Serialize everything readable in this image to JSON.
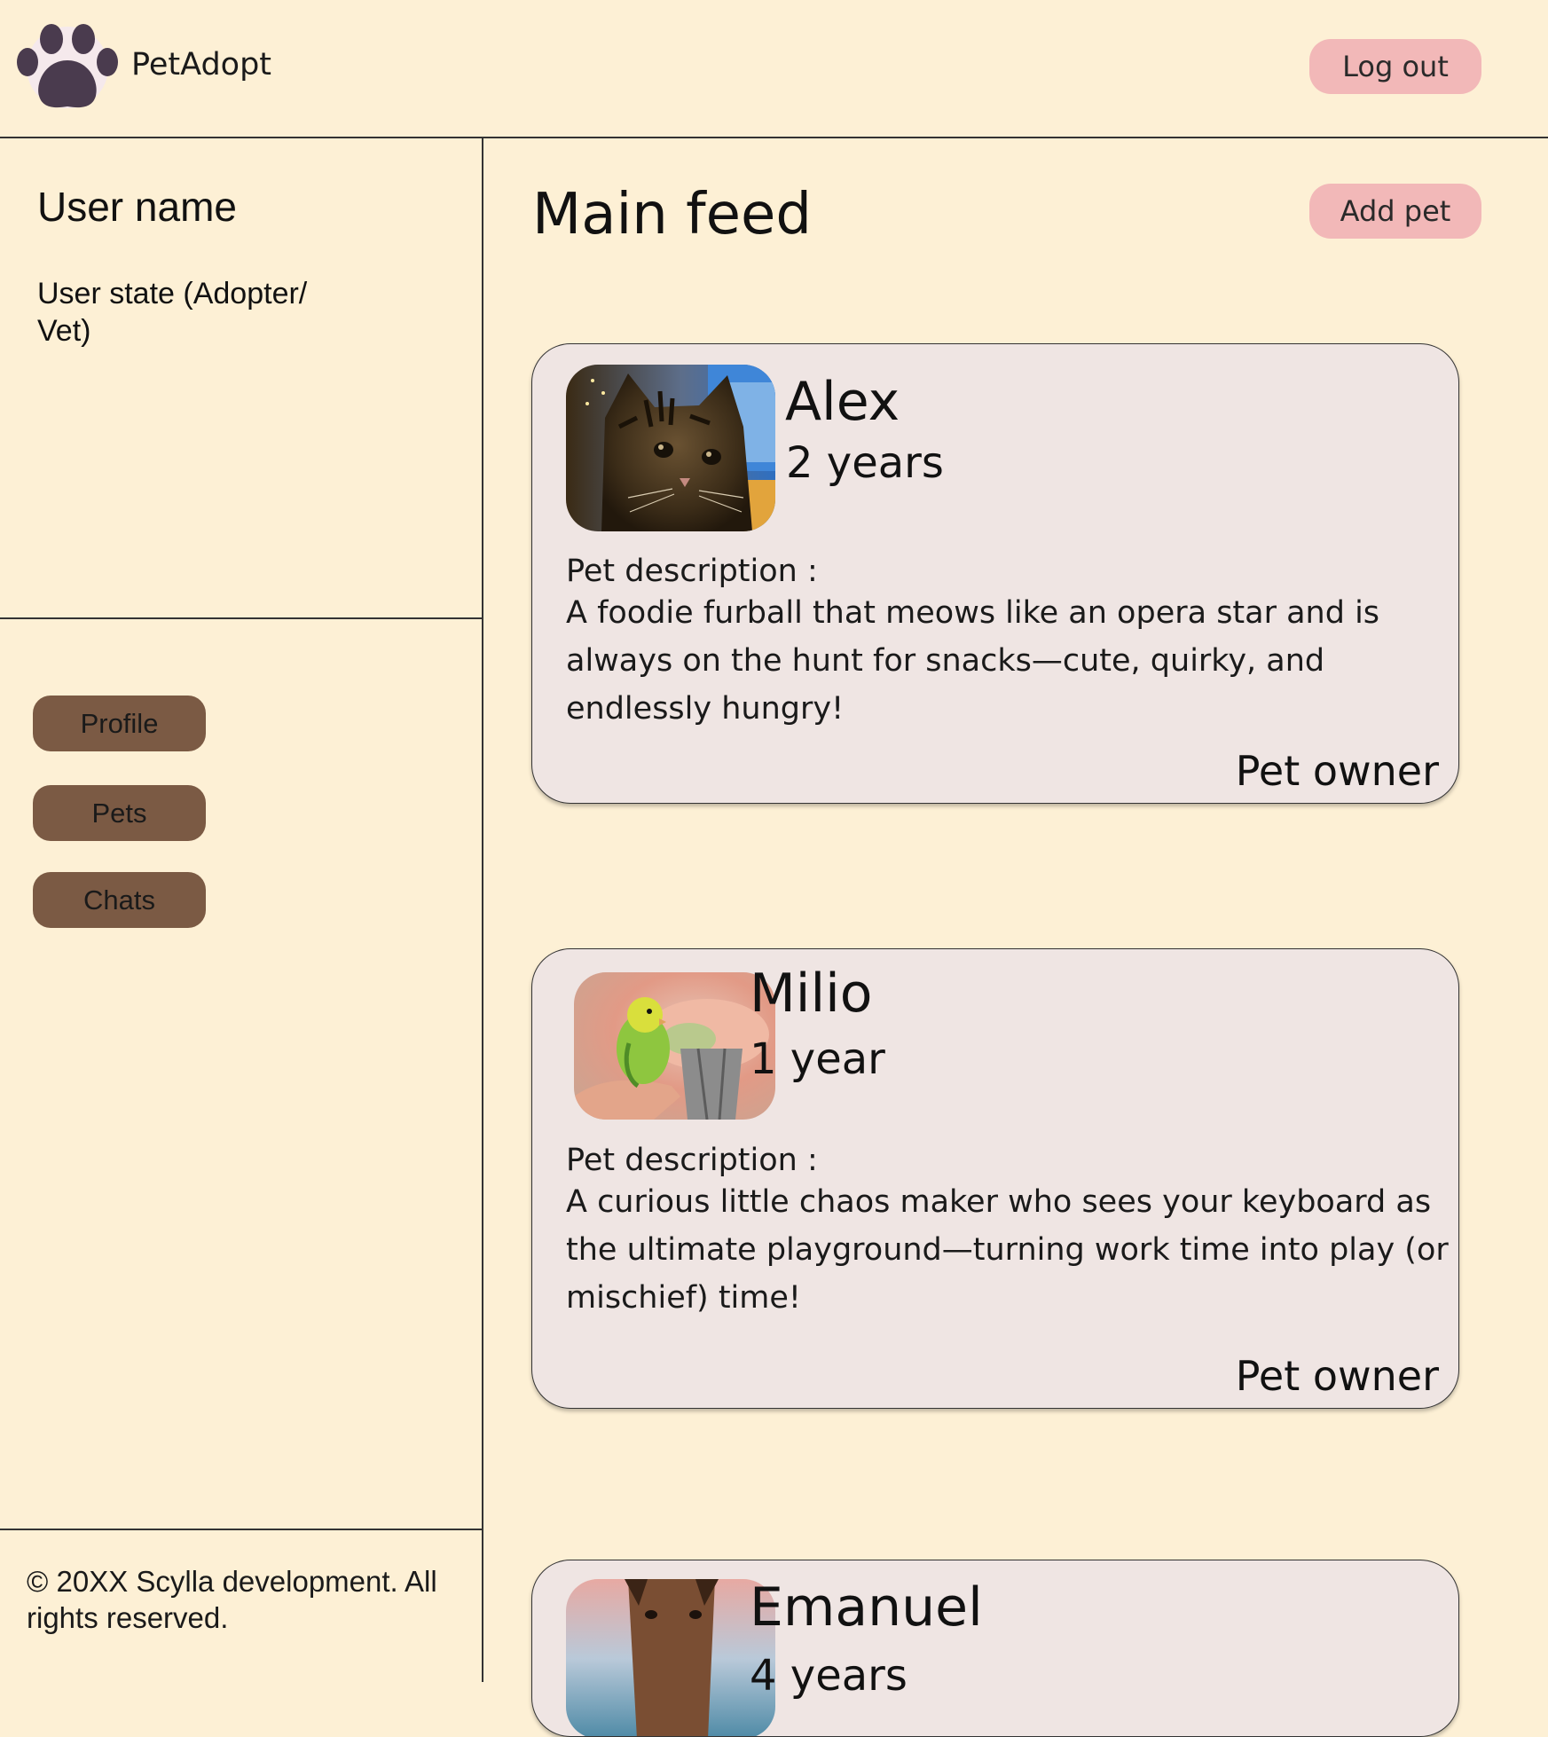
{
  "app": {
    "name": "PetAdopt",
    "logo_icon": "paw-icon"
  },
  "header": {
    "logout_label": "Log out"
  },
  "sidebar": {
    "user_name": "User name",
    "user_state": "User state (Adopter/ Vet)",
    "nav": [
      {
        "label": "Profile"
      },
      {
        "label": "Pets"
      },
      {
        "label": "Chats"
      }
    ],
    "copyright": "© 20XX Scylla development. All rights reserved."
  },
  "main": {
    "title": "Main feed",
    "add_pet_label": "Add pet",
    "pets": [
      {
        "name": "Alex",
        "age": "2 years",
        "photo": "cat-photo",
        "description_label": "Pet description :",
        "description": "A foodie furball that meows like an opera star and is always on the hunt for snacks—cute, quirky, and endlessly hungry!",
        "owner_label": "Pet owner"
      },
      {
        "name": "Milio",
        "age": "1 year",
        "photo": "parakeet-photo",
        "description_label": "Pet description :",
        "description": "A curious little chaos maker who sees your keyboard as the ultimate playground—turning work time into play (or mischief) time!",
        "owner_label": "Pet owner"
      },
      {
        "name": "Emanuel",
        "age": "4 years",
        "photo": "horse-photo"
      }
    ]
  },
  "colors": {
    "background": "#fdf0d5",
    "accent_button": "#f2b8b8",
    "nav_button": "#7b5a44",
    "card": "#efe5e3",
    "logo": "#4a3b4e"
  }
}
